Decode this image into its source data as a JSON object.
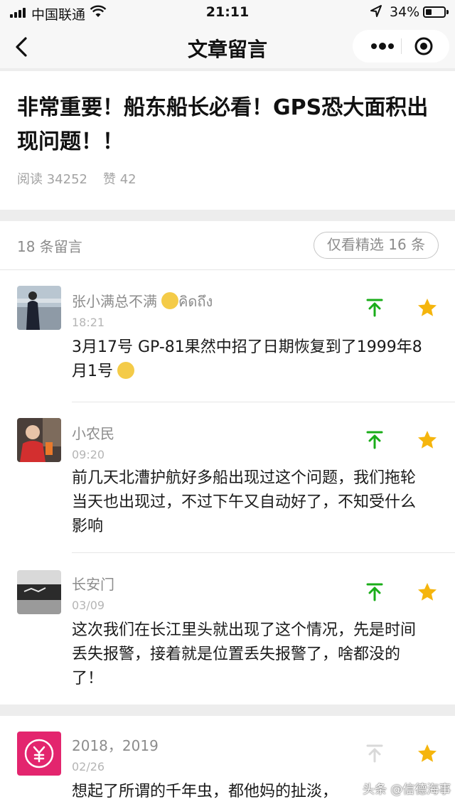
{
  "status_bar": {
    "carrier": "中国联通",
    "time": "21:11",
    "battery_text": "34%",
    "battery_level": 0.34
  },
  "nav": {
    "title": "文章留言"
  },
  "article": {
    "title": "非常重要！船东船长必看！GPS恐大面积出现问题！！",
    "reads": "阅读 34252",
    "likes": "赞 42"
  },
  "comments_header": {
    "count_label": "18 条留言",
    "filter_label": "仅看精选 16 条"
  },
  "comments": [
    {
      "nickname": "张小满总不满",
      "nickname_suffix": "คิดถึง",
      "time": "18:21",
      "text": "3月17号 GP-81果然中招了日期恢复到了1999年8月1号"
    },
    {
      "nickname": "小农民",
      "time": "09:20",
      "text": "前几天北漕护航好多船出现过这个问题，我们拖轮当天也出现过，不过下午又自动好了，不知受什么影响"
    },
    {
      "nickname": "长安门",
      "time": "03/09",
      "text": "这次我们在长江里头就出现了这个情况，先是时间丢失报警，接着就是位置丢失报警了，啥都没的了！"
    },
    {
      "nickname": "2018，2019",
      "time": "02/26",
      "text": "想起了所谓的千年虫，都他妈的扯淡，"
    }
  ],
  "watermark": "头条 @信德海事",
  "colors": {
    "up_green": "#1aad19",
    "up_disabled": "#d9d9d9",
    "star_yellow": "#f5b50d"
  }
}
